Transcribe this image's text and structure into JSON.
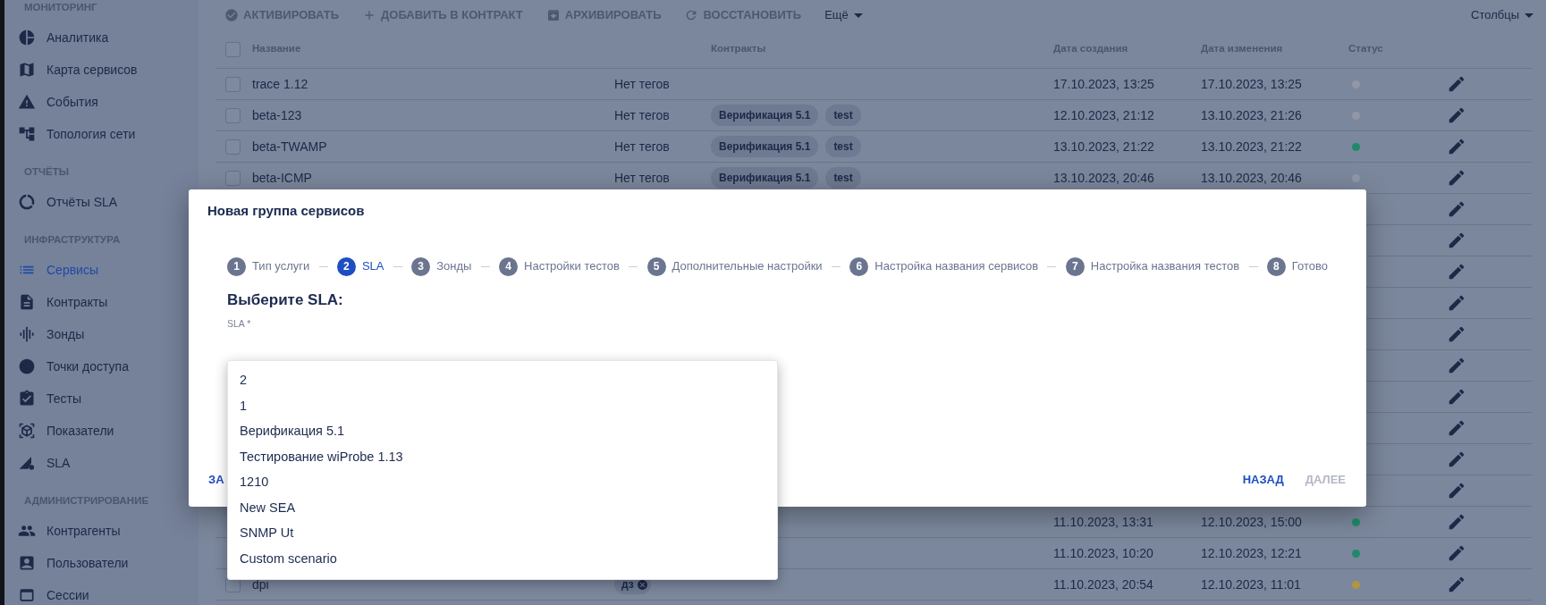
{
  "sidebar": {
    "sections": [
      {
        "title": "МОНИТОРИНГ",
        "items": [
          {
            "label": "Аналитика",
            "selected": false
          },
          {
            "label": "Карта сервисов",
            "selected": false
          },
          {
            "label": "События",
            "selected": false
          },
          {
            "label": "Топология сети",
            "selected": false
          }
        ]
      },
      {
        "title": "ОТЧЁТЫ",
        "items": [
          {
            "label": "Отчёты SLA",
            "selected": false
          }
        ]
      },
      {
        "title": "ИНФРАСТРУКТУРА",
        "items": [
          {
            "label": "Сервисы",
            "selected": true
          },
          {
            "label": "Контракты",
            "selected": false
          },
          {
            "label": "Зонды",
            "selected": false
          },
          {
            "label": "Точки доступа",
            "selected": false
          },
          {
            "label": "Тесты",
            "selected": false
          },
          {
            "label": "Показатели",
            "selected": false
          },
          {
            "label": "SLA",
            "selected": false
          }
        ]
      },
      {
        "title": "АДМИНИСТРИРОВАНИЕ",
        "items": [
          {
            "label": "Контрагенты",
            "selected": false
          },
          {
            "label": "Пользователи",
            "selected": false
          },
          {
            "label": "Сессии",
            "selected": false
          }
        ]
      }
    ]
  },
  "toolbar": {
    "actions": [
      {
        "label": "АКТИВИРОВАТЬ"
      },
      {
        "label": "ДОБАВИТЬ В КОНТРАКТ"
      },
      {
        "label": "АРХИВИРОВАТЬ"
      },
      {
        "label": "ВОССТАНОВИТЬ"
      }
    ],
    "more": "Ещё",
    "columns_button": "Столбцы"
  },
  "table": {
    "select_all_checked": false,
    "columns": [
      "Название",
      "Контракты",
      "Дата создания",
      "Дата изменения",
      "Статус"
    ],
    "rows": [
      {
        "checked": false,
        "name": "trace 1.12",
        "no_tags": "Нет тегов",
        "contracts": [],
        "created": "17.10.2023, 13:25",
        "modified": "17.10.2023, 13:25",
        "color": "#8f97a8"
      },
      {
        "checked": false,
        "name": "beta-123",
        "no_tags": "Нет тегов",
        "contracts": [
          "Верификация 5.1",
          "test"
        ],
        "created": "12.10.2023, 21:12",
        "modified": "13.10.2023, 21:26",
        "color": "#8f97a8"
      },
      {
        "checked": false,
        "name": "beta-TWAMP",
        "no_tags": "Нет тегов",
        "contracts": [
          "Верификация 5.1",
          "test"
        ],
        "created": "13.10.2023, 21:22",
        "modified": "13.10.2023, 21:22",
        "color": "#1f8a6a"
      },
      {
        "checked": false,
        "name": "beta-ICMP",
        "no_tags": "Нет тегов",
        "contracts": [
          "Верификация 5.1",
          "test"
        ],
        "created": "13.10.2023, 20:46",
        "modified": "13.10.2023, 20:46",
        "color": "#8f97a8"
      },
      {},
      {},
      {},
      {},
      {},
      {},
      {},
      {},
      {},
      {},
      {
        "created": "11.10.2023, 13:31",
        "modified": "12.10.2023, 15:00",
        "color": "#1f8a6a"
      },
      {
        "created": "11.10.2023, 10:20",
        "modified": "12.10.2023, 12:21",
        "color": "#1f8a6a"
      },
      {
        "checked": false,
        "name": "dpi",
        "tags": [
          "дз"
        ],
        "created": "11.10.2023, 20:54",
        "modified": "12.10.2023, 11:01",
        "color": "#b0963c"
      }
    ]
  },
  "modal": {
    "title": "Новая группа сервисов",
    "steps": [
      {
        "number": "1",
        "label": "Тип услуги",
        "selected": false
      },
      {
        "number": "2",
        "label": "SLA",
        "selected": true
      },
      {
        "number": "3",
        "label": "Зонды",
        "selected": false
      },
      {
        "number": "4",
        "label": "Настройки тестов",
        "selected": false
      },
      {
        "number": "5",
        "label": "Дополнительные настройки",
        "selected": false
      },
      {
        "number": "6",
        "label": "Настройка названия сервисов",
        "selected": false
      },
      {
        "number": "7",
        "label": "Настройка названия тестов",
        "selected": false
      },
      {
        "number": "8",
        "label": "Готово",
        "selected": false
      }
    ],
    "heading": "Выберите SLA:",
    "field_label": "SLA *",
    "options": [
      "2",
      "1",
      "Верификация 5.1",
      "Тестирование wiProbe 1.13",
      "1210",
      "New SEA",
      "SNMP Ut",
      "Custom scenario"
    ],
    "buttons": [
      {
        "label": "ЗА",
        "kind": "left",
        "disabled": false
      },
      {
        "label": "НАЗАД",
        "kind": "right",
        "disabled": false
      },
      {
        "label": "ДАЛЕЕ",
        "kind": "right",
        "disabled": true
      }
    ]
  }
}
